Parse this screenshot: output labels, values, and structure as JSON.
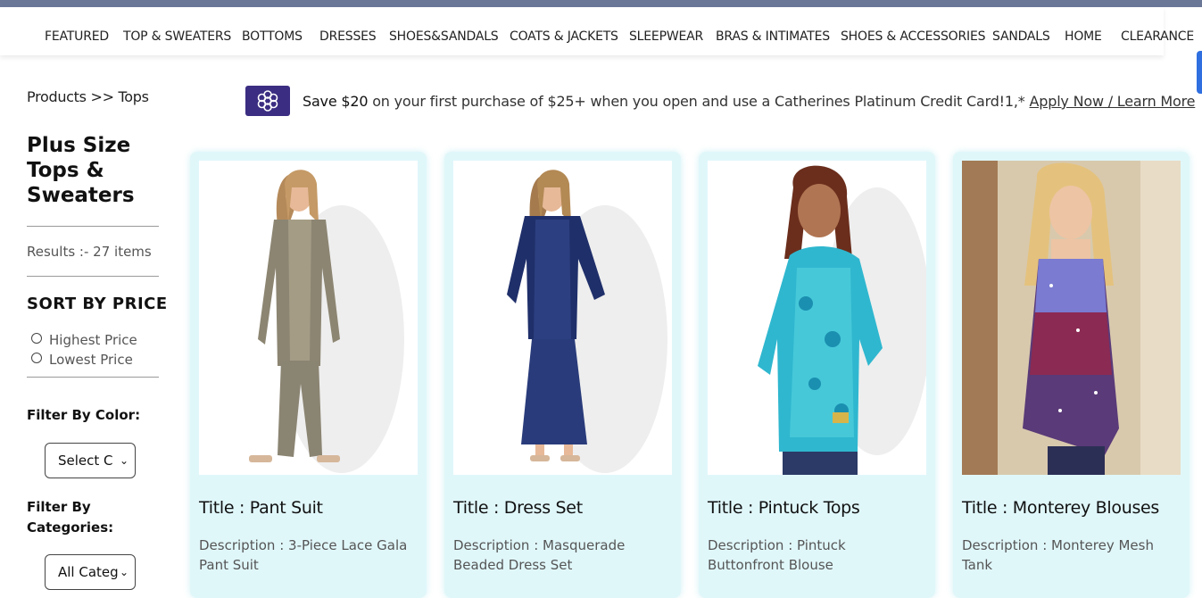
{
  "nav": {
    "items": [
      "FEATURED",
      "TOP & SWEATERS",
      "BOTTOMS",
      "DRESSES",
      "SHOES&SANDALS",
      "COATS & JACKETS",
      "SLEEPWEAR",
      "BRAS & INTIMATES",
      "SHOES & ACCESSORIES",
      "SANDALS",
      "HOME",
      "CLEARANCE"
    ]
  },
  "sidebar": {
    "breadcrumb": "Products >> Tops",
    "title": "Plus Size Tops & Sweaters",
    "results": "Results :- 27 items",
    "sort_title": "SORT BY PRICE",
    "sort_options": [
      "Highest Price",
      "Lowest Price"
    ],
    "color_filter_label": "Filter By Color:",
    "color_select_value": "Select C",
    "category_filter_label": "Filter By Categories:",
    "category_select_value": "All Categ"
  },
  "promo": {
    "highlight": "Save $20",
    "text": " on your first purchase of $25+ when you open and use a Catherines Platinum Credit Card!1,*",
    "link": "Apply Now / Learn More",
    "badge_color": "#3b2d82"
  },
  "products": [
    {
      "title": "Title : Pant Suit",
      "description": "Description : 3-Piece Lace Gala Pant Suit",
      "image": "woman-taupe-pant-suit"
    },
    {
      "title": "Title : Dress Set",
      "description": "Description : Masquerade Beaded Dress Set",
      "image": "woman-navy-dress-set"
    },
    {
      "title": "Title : Pintuck Tops",
      "description": "Description : Pintuck Buttonfront Blouse",
      "image": "woman-turquoise-blouse"
    },
    {
      "title": "Title : Monterey Blouses",
      "description": "Description : Monterey Mesh Tank",
      "image": "woman-ombre-tank"
    }
  ],
  "colors": {
    "top_strip": "#6b7797",
    "card_bg": "#e0f7fa",
    "accent": "#2f6fe0"
  }
}
